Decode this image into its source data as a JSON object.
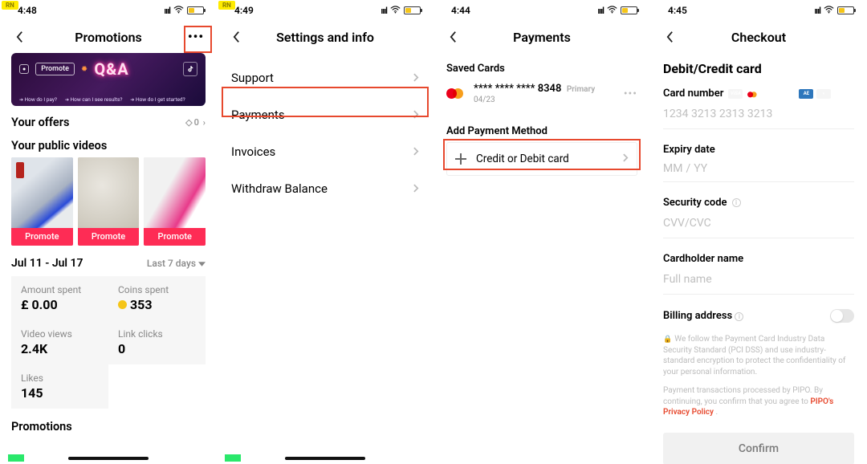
{
  "s1": {
    "rn_tag": "RN",
    "status_time": "4:48",
    "nav_title": "Promotions",
    "banner": {
      "promote_chip": "Promote",
      "qa": "Q&A",
      "links": [
        "How do I pay?",
        "How can I see results?",
        "How do I get started?"
      ]
    },
    "offers_head": "Your offers",
    "offers_count": "0",
    "videos_head": "Your public videos",
    "promote_label": "Promote",
    "range_text": "Jul 11 - Jul 17",
    "range_select": "Last 7 days",
    "stats": {
      "amount_spent_label": "Amount spent",
      "amount_spent_value": "£ 0.00",
      "coins_spent_label": "Coins spent",
      "coins_spent_value": "353",
      "video_views_label": "Video views",
      "video_views_value": "2.4K",
      "link_clicks_label": "Link clicks",
      "link_clicks_value": "0",
      "likes_label": "Likes",
      "likes_value": "145"
    },
    "promotions_head": "Promotions"
  },
  "s2": {
    "rn_tag": "RN",
    "status_time": "4:49",
    "nav_title": "Settings and info",
    "rows": {
      "support": "Support",
      "payments": "Payments",
      "invoices": "Invoices",
      "withdraw": "Withdraw Balance"
    }
  },
  "s3": {
    "status_time": "4:44",
    "nav_title": "Payments",
    "saved_label": "Saved Cards",
    "card_masked": "**** **** **** 8348",
    "card_expiry": "04/23",
    "primary_label": "Primary",
    "add_label": "Add Payment Method",
    "add_row_label": "Credit or Debit card"
  },
  "s4": {
    "status_time": "4:45",
    "nav_title": "Checkout",
    "form_title": "Debit/Credit card",
    "card_number_label": "Card number",
    "card_number_ph": "1234 3213 2313 3213",
    "expiry_label": "Expiry date",
    "expiry_mm": "MM",
    "expiry_yy": "YY",
    "security_label": "Security code",
    "security_ph": "CVV/CVC",
    "holder_label": "Cardholder name",
    "holder_ph": "Full name",
    "billing_label": "Billing address",
    "disc1_a": "We follow the Payment Card Industry Data Security Standard (PCI DSS) and use industry-standard encryption to protect the confidentiality of your personal information.",
    "disc2_a": "Payment transactions processed by PIPO. By continuing, you confirm that you agree to ",
    "disc2_link": "PIPO's Privacy Policy",
    "confirm_label": "Confirm"
  }
}
